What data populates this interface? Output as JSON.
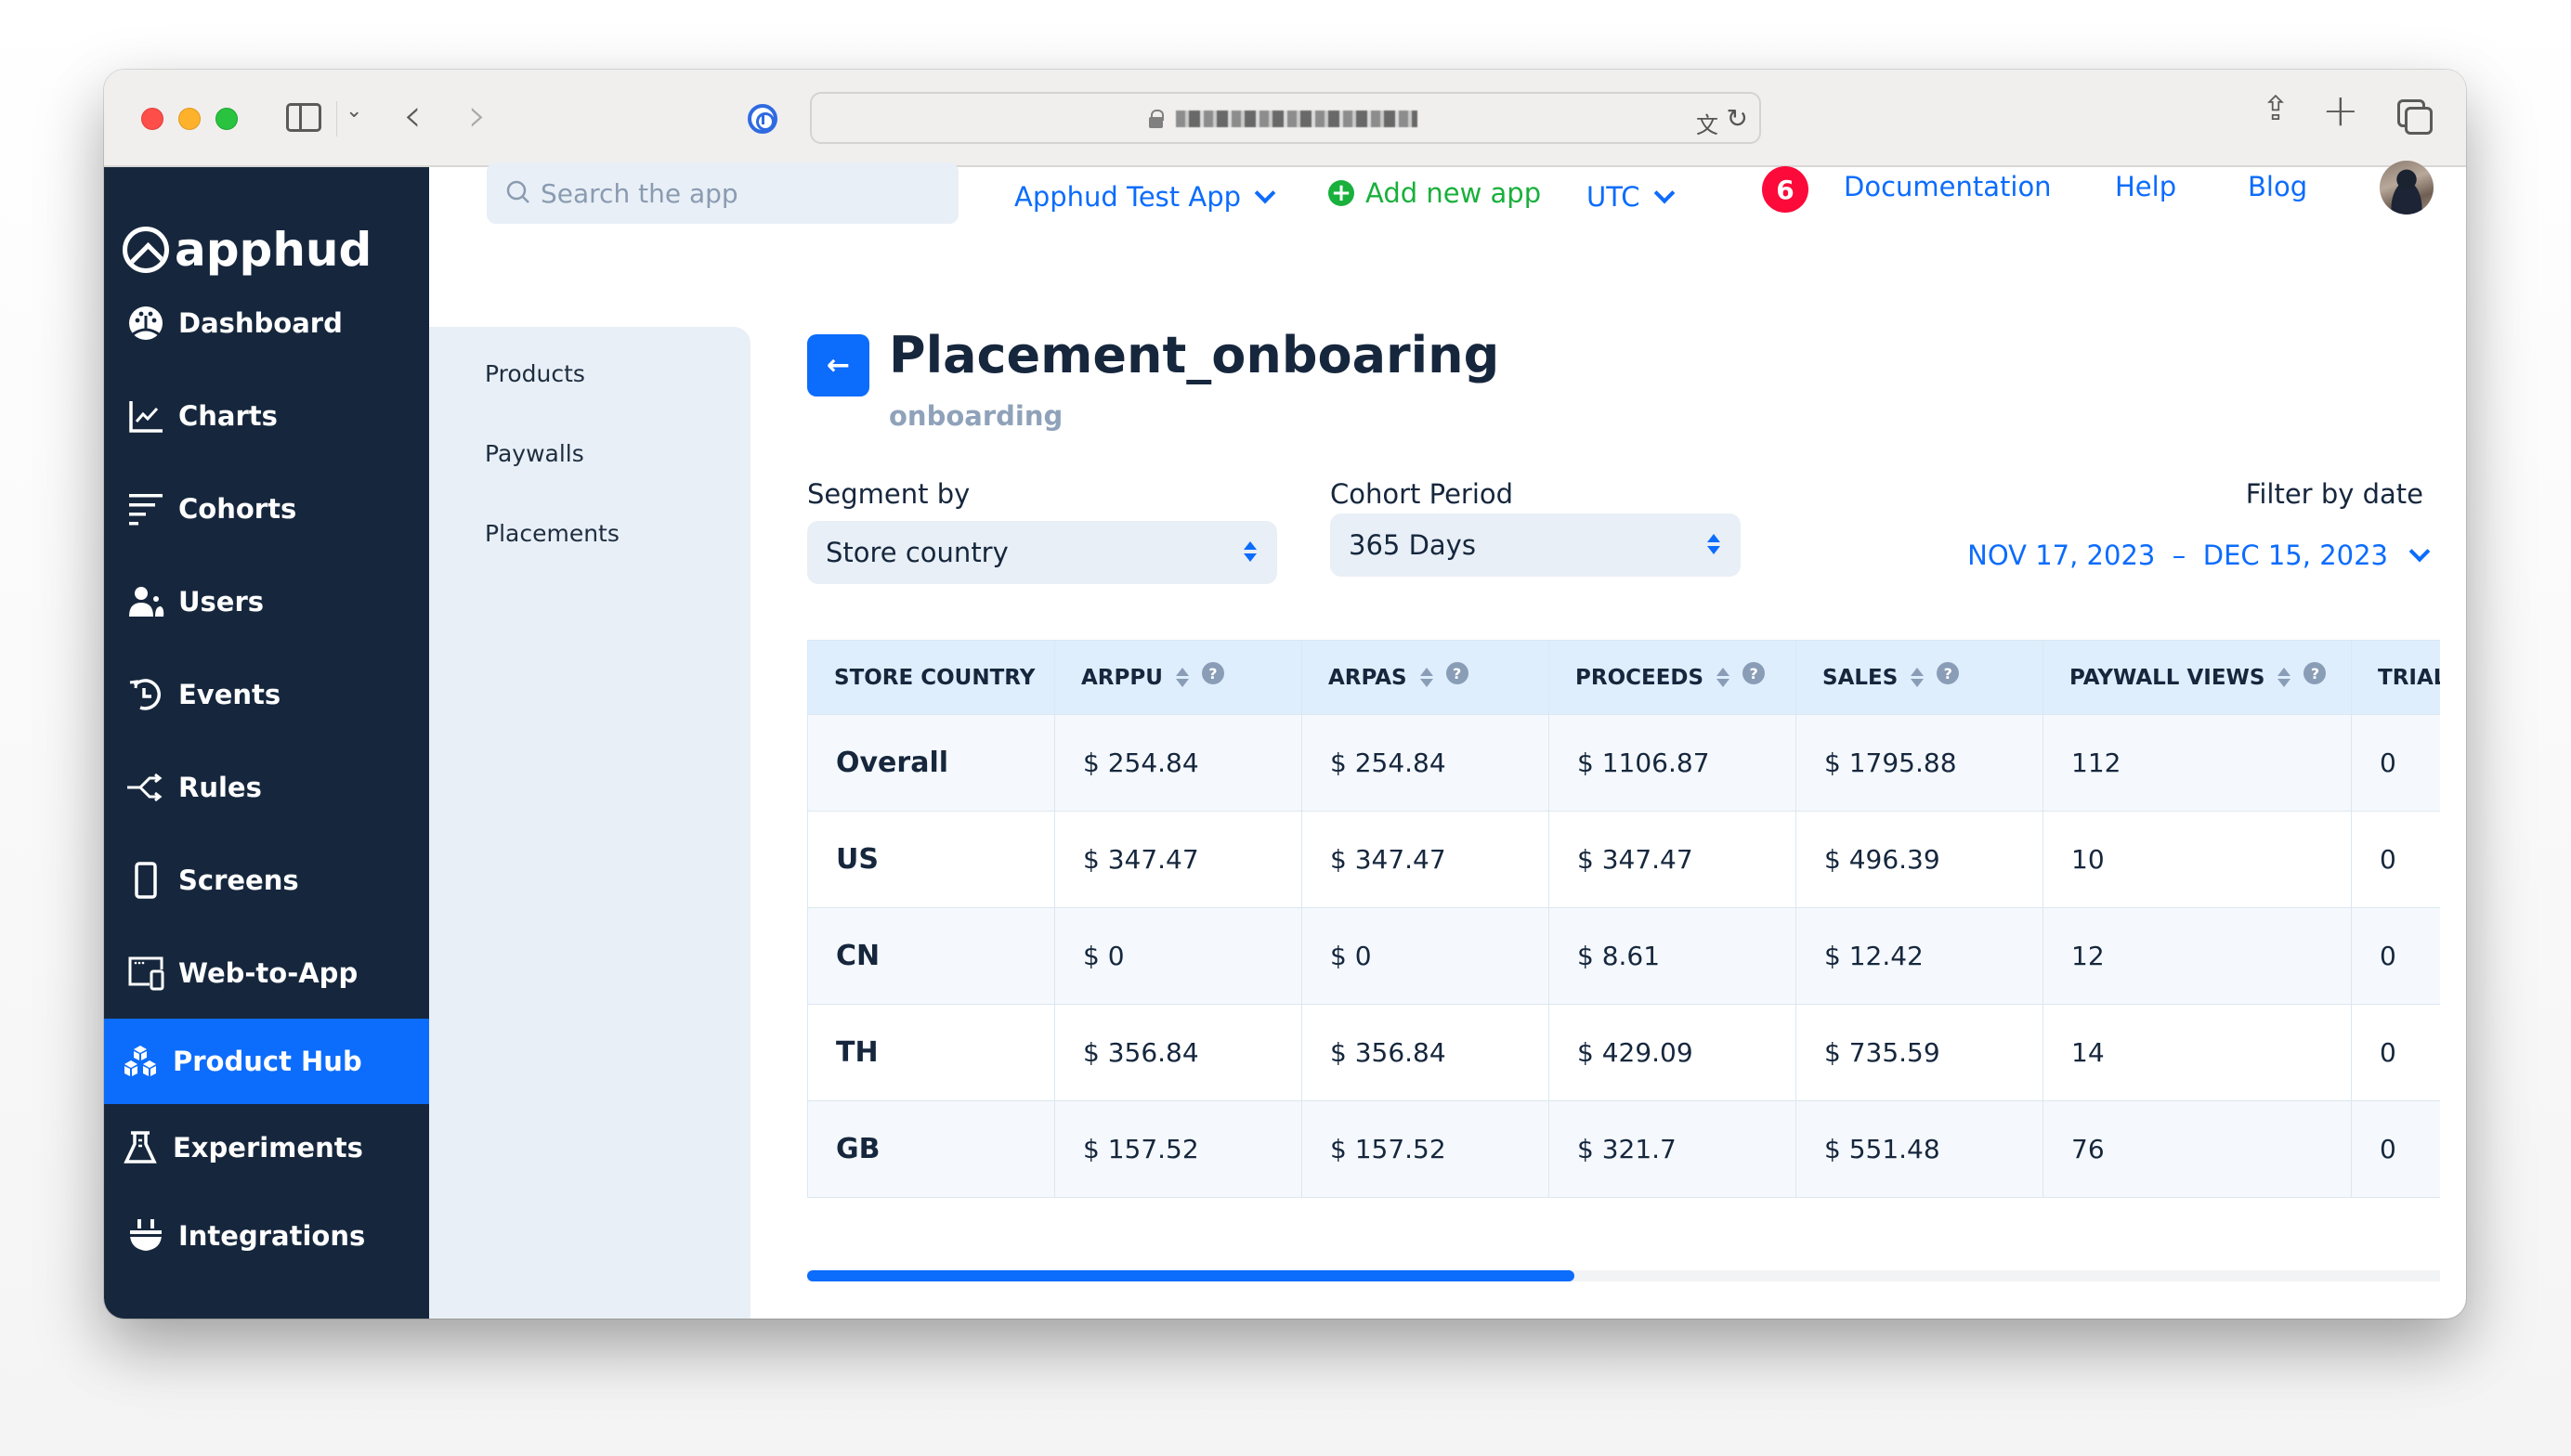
{
  "browser": {
    "address_masked": true,
    "toolbar_icons": [
      "sidebar-toggle-icon",
      "chevron-down-icon",
      "back-icon",
      "forward-icon",
      "password-manager-icon",
      "lock-icon",
      "translate-icon",
      "reload-icon",
      "share-icon",
      "new-tab-icon",
      "tab-overview-icon"
    ]
  },
  "sidebar": {
    "logo": "apphud",
    "items": [
      {
        "label": "Dashboard",
        "icon": "dashboard-icon",
        "active": false
      },
      {
        "label": "Charts",
        "icon": "chart-icon",
        "active": false
      },
      {
        "label": "Cohorts",
        "icon": "cohorts-icon",
        "active": false
      },
      {
        "label": "Users",
        "icon": "users-icon",
        "active": false
      },
      {
        "label": "Events",
        "icon": "history-icon",
        "active": false
      },
      {
        "label": "Rules",
        "icon": "rules-icon",
        "active": false
      },
      {
        "label": "Screens",
        "icon": "phone-icon",
        "active": false
      },
      {
        "label": "Web-to-App",
        "icon": "web-to-app-icon",
        "active": false
      },
      {
        "label": "Product Hub",
        "icon": "cubes-icon",
        "active": true
      },
      {
        "label": "Experiments",
        "icon": "flask-icon",
        "active": false
      },
      {
        "label": "Integrations",
        "icon": "plug-icon",
        "active": false
      }
    ],
    "active_color": "#0c6cfc",
    "background": "#16273d"
  },
  "header": {
    "search_placeholder": "Search the app",
    "app_select": "Apphud Test App",
    "add_app": "Add new app",
    "timezone": "UTC",
    "notification_count": "6",
    "links": {
      "documentation": "Documentation",
      "help": "Help",
      "blog": "Blog"
    }
  },
  "subnav": {
    "items": [
      "Products",
      "Paywalls",
      "Placements"
    ]
  },
  "page": {
    "title": "Placement_onboaring",
    "subtitle": "onboarding",
    "segment_label": "Segment by",
    "segment_value": "Store country",
    "cohort_label": "Cohort Period",
    "cohort_value": "365 Days",
    "filter_label": "Filter by date",
    "date_range": "NOV 17, 2023  –  DEC 15, 2023"
  },
  "table": {
    "columns": [
      {
        "label": "STORE COUNTRY",
        "sortable": false,
        "help": false
      },
      {
        "label": "ARPPU",
        "sortable": true,
        "help": true
      },
      {
        "label": "ARPAS",
        "sortable": true,
        "help": true
      },
      {
        "label": "PROCEEDS",
        "sortable": true,
        "help": true
      },
      {
        "label": "SALES",
        "sortable": true,
        "help": true
      },
      {
        "label": "PAYWALL VIEWS",
        "sortable": true,
        "help": true
      },
      {
        "label": "TRIAL",
        "sortable": false,
        "help": false
      }
    ],
    "rows": [
      [
        "Overall",
        "$ 254.84",
        "$ 254.84",
        "$ 1106.87",
        "$ 1795.88",
        "112",
        "0"
      ],
      [
        "US",
        "$ 347.47",
        "$ 347.47",
        "$ 347.47",
        "$ 496.39",
        "10",
        "0"
      ],
      [
        "CN",
        "$ 0",
        "$ 0",
        "$ 8.61",
        "$ 12.42",
        "12",
        "0"
      ],
      [
        "TH",
        "$ 356.84",
        "$ 356.84",
        "$ 429.09",
        "$ 735.59",
        "14",
        "0"
      ],
      [
        "GB",
        "$ 157.52",
        "$ 157.52",
        "$ 321.7",
        "$ 551.48",
        "76",
        "0"
      ]
    ],
    "horizontal_scroll_fraction": 0.47
  }
}
